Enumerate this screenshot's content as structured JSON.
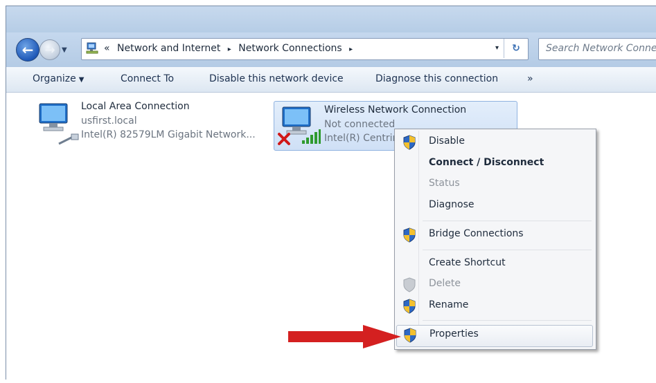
{
  "address": {
    "overflow": "«",
    "crumbs": [
      "Network and Internet",
      "Network Connections"
    ],
    "separator": "▸",
    "dropdown": "▾",
    "refresh": "↻"
  },
  "search": {
    "placeholder": "Search Network Connections"
  },
  "toolbar": {
    "organize": "Organize",
    "connect_to": "Connect To",
    "disable": "Disable this network device",
    "diagnose": "Diagnose this connection",
    "more": "»"
  },
  "connections": [
    {
      "name": "Local Area Connection",
      "status": "usfirst.local",
      "device": "Intel(R) 82579LM Gigabit Network..."
    },
    {
      "name": "Wireless Network Connection",
      "status": "Not connected",
      "device": "Intel(R) Centrino..."
    }
  ],
  "context_menu": {
    "items": [
      {
        "label": "Disable",
        "shield": true,
        "style": "normal"
      },
      {
        "label": "Connect / Disconnect",
        "shield": false,
        "style": "bold"
      },
      {
        "label": "Status",
        "shield": false,
        "style": "disabled"
      },
      {
        "label": "Diagnose",
        "shield": false,
        "style": "normal"
      },
      {
        "label": "Bridge Connections",
        "shield": true,
        "style": "normal"
      },
      {
        "label": "Create Shortcut",
        "shield": false,
        "style": "normal"
      },
      {
        "label": "Delete",
        "shield": true,
        "style": "disabled"
      },
      {
        "label": "Rename",
        "shield": true,
        "style": "normal"
      },
      {
        "label": "Properties",
        "shield": true,
        "style": "highlighted"
      }
    ]
  },
  "colors": {
    "accent_arrow": "#d42020",
    "highlight_border": "#b7c2d1"
  },
  "icons": [
    "back-icon",
    "forward-icon",
    "network-folder-icon",
    "refresh-icon",
    "computer-icon",
    "ethernet-icon",
    "signal-bars-icon",
    "red-x-icon",
    "uac-shield-icon",
    "red-arrow-icon"
  ]
}
